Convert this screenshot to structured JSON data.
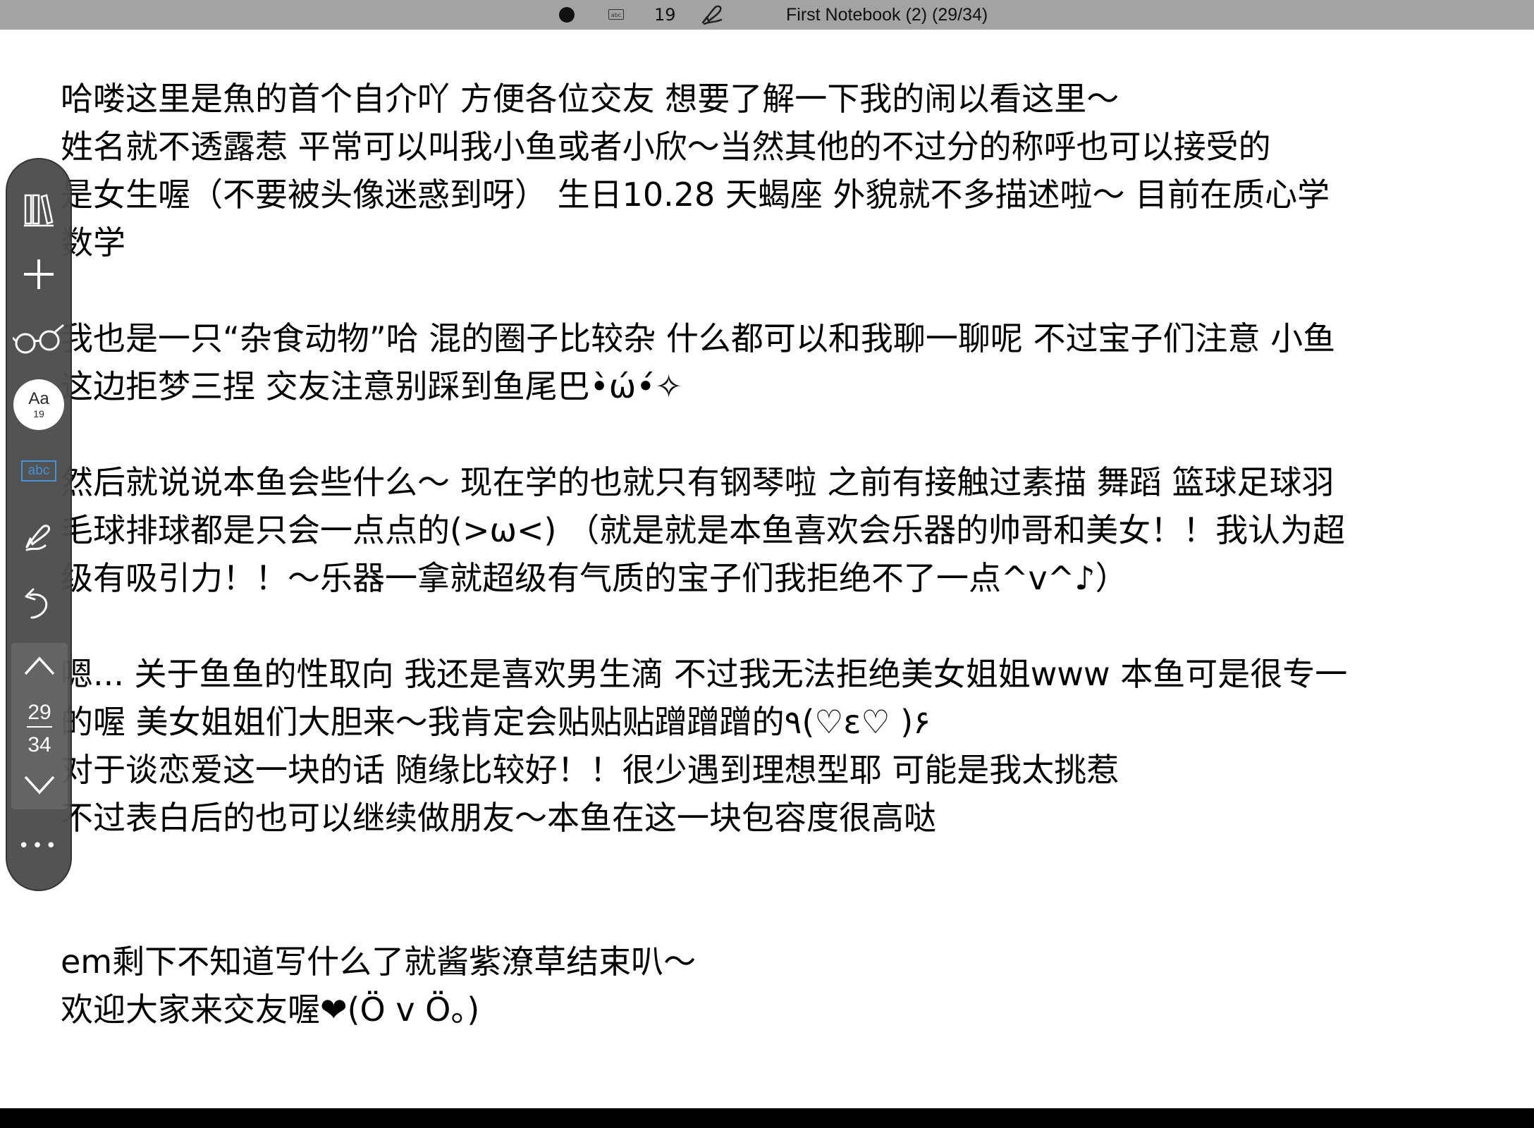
{
  "topbar": {
    "font_size": "19",
    "title": "First Notebook (2) (29/34)",
    "icons": [
      "record-dot-icon",
      "abc-text-icon",
      "pen-icon"
    ]
  },
  "content": {
    "lines": [
      "哈喽这里是魚的首个自介吖 方便各位交友 想要了解一下我的闹以看这里～",
      "姓名就不透露惹 平常可以叫我小鱼或者小欣～当然其他的不过分的称呼也可以接受的",
      "是女生喔（不要被头像迷惑到呀） 生日10.28 天蝎座  外貌就不多描述啦～  目前在质心学",
      "数学",
      "",
      "我也是一只“杂食动物”哈 混的圈子比较杂 什么都可以和我聊一聊呢 不过宝子们注意 小鱼",
      "这边拒梦三捏 交友注意别踩到鱼尾巴•̀ώ•́✧",
      "",
      "然后就说说本鱼会些什么～ 现在学的也就只有钢琴啦 之前有接触过素描 舞蹈 篮球足球羽",
      "毛球排球都是只会一点点的(>ω<) （就是就是本鱼喜欢会乐器的帅哥和美女！！我认为超",
      "级有吸引力！！～乐器一拿就超级有气质的宝子们我拒绝不了一点^v^♪）",
      "",
      "嗯... 关于鱼鱼的性取向 我还是喜欢男生滴  不过我无法拒绝美女姐姐www 本鱼可是很专一",
      "的喔 美女姐姐们大胆来～我肯定会贴贴贴蹭蹭蹭的٩(♡ε♡ )۶",
      "对于谈恋爱这一块的话 随缘比较好！！很少遇到理想型耶 可能是我太挑惹",
      "不过表白后的也可以继续做朋友～本鱼在这一块包容度很高哒",
      "",
      "",
      "em剩下不知道写什么了就酱紫潦草结束叭～",
      "欢迎大家来交友喔❤(Ö v Ö。)"
    ]
  },
  "sidebar": {
    "font_button_label": "Aa",
    "font_button_size": "19",
    "abc_label": "abc",
    "current_page": "29",
    "total_pages": "34",
    "more_label": "•••",
    "icons": [
      "library-icon",
      "add-icon",
      "glasses-icon",
      "abc-text-icon",
      "pen-icon",
      "undo-icon",
      "chevron-up-icon",
      "chevron-down-icon",
      "more-icon"
    ]
  },
  "colors": {
    "topbar_bg": "#a3a3a3",
    "sidebar_bg": "#4d4d4d",
    "abc_accent": "#3b8fd6",
    "page_bg": "#ffffff"
  }
}
